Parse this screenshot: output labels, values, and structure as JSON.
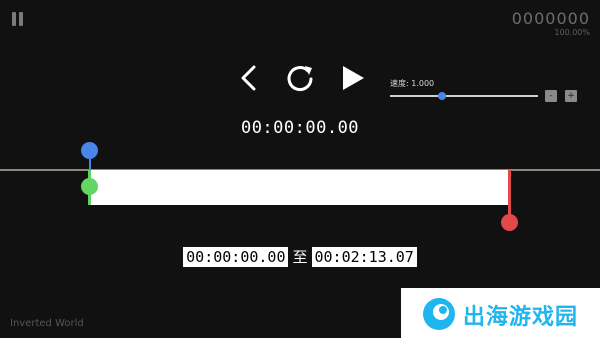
{
  "hud": {
    "score": "0000000",
    "percent": "100.00%"
  },
  "controls": {
    "prev_icon": "chevron-left-icon",
    "restart_icon": "restart-icon",
    "play_icon": "play-icon"
  },
  "playback": {
    "current_time": "00:00:00.00"
  },
  "speed": {
    "label": "速度: 1.000",
    "value": 1.0,
    "minus_label": "-",
    "plus_label": "+"
  },
  "timeline": {
    "start_marker_color": "#63d563",
    "cursor_color": "#4a86e8",
    "end_marker_color": "#e04a4a"
  },
  "range": {
    "start": "00:00:00.00",
    "separator": "至",
    "end": "00:02:13.07"
  },
  "footer": {
    "song_title": "Inverted World"
  },
  "watermark": {
    "text": "出海游戏园"
  }
}
